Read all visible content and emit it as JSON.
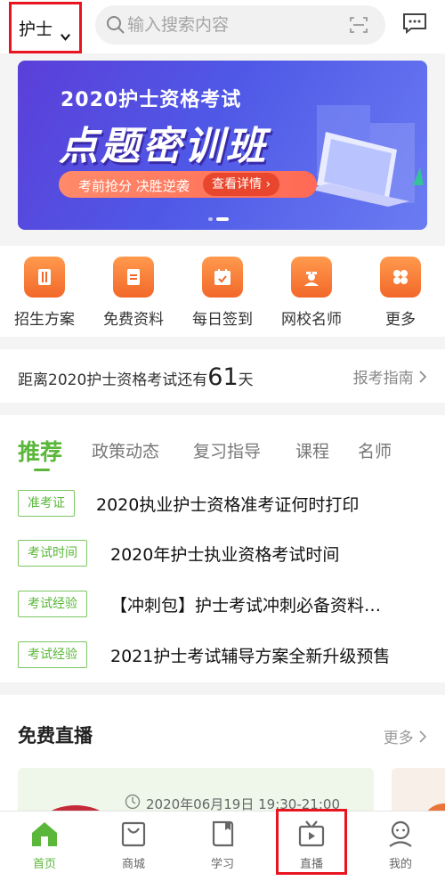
{
  "header": {
    "category_label": "护士",
    "search_placeholder": "输入搜索内容"
  },
  "banner": {
    "title": "2020护士资格考试",
    "main": "点题密训班",
    "slogan": "考前抢分 决胜逆袭",
    "cta": "查看详情 ›"
  },
  "quick_links": [
    {
      "label": "招生方案",
      "icon": "book-icon"
    },
    {
      "label": "免费资料",
      "icon": "document-icon"
    },
    {
      "label": "每日签到",
      "icon": "calendar-check-icon"
    },
    {
      "label": "网校名师",
      "icon": "nurse-icon"
    },
    {
      "label": "更多",
      "icon": "grid-icon"
    }
  ],
  "countdown": {
    "prefix": "距离2020护士资格考试还有",
    "days": "61",
    "suffix": "天",
    "guide": "报考指南"
  },
  "news": {
    "tabs": [
      "推荐",
      "政策动态",
      "复习指导",
      "课程",
      "名师"
    ],
    "items": [
      {
        "tag": "准考证",
        "title": "2020执业护士资格准考证何时打印"
      },
      {
        "tag": "考试时间",
        "title": "2020年护士执业资格考试时间"
      },
      {
        "tag": "考试经验",
        "title": "【冲刺包】护士考试冲刺必备资料…"
      },
      {
        "tag": "考试经验",
        "title": "2021护士考试辅导方案全新升级预售"
      }
    ]
  },
  "live": {
    "title": "免费直播",
    "more": "更多",
    "time": "2020年06月19日 19:30-21:00"
  },
  "nav": [
    {
      "label": "首页",
      "icon": "home-icon",
      "active": true
    },
    {
      "label": "商城",
      "icon": "shop-bag-icon",
      "active": false
    },
    {
      "label": "学习",
      "icon": "study-book-icon",
      "active": false
    },
    {
      "label": "直播",
      "icon": "tv-icon",
      "active": false
    },
    {
      "label": "我的",
      "icon": "profile-icon",
      "active": false
    }
  ],
  "colors": {
    "accent": "#5bb73a",
    "highlight_box": "#e8141f",
    "quick_icon": "#f2682a"
  }
}
